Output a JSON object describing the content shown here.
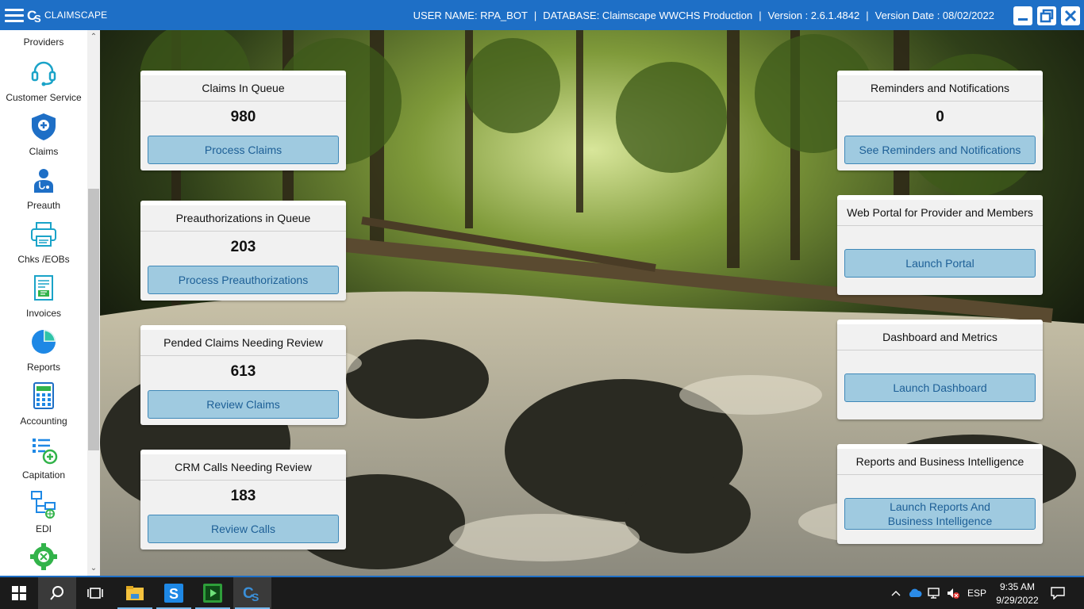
{
  "titlebar": {
    "app_name": "CLAIMSCAPE",
    "user_label": "USER NAME: RPA_BOT",
    "database_label": "DATABASE: Claimscape WWCHS Production",
    "version_label": "Version : 2.6.1.4842",
    "version_date_label": "Version Date : 08/02/2022",
    "separator": "|",
    "brand_color": "#1e6fc6"
  },
  "sidebar": {
    "items": [
      {
        "label": "Providers",
        "icon": "providers-icon"
      },
      {
        "label": "Customer Service",
        "icon": "headset-icon"
      },
      {
        "label": "Claims",
        "icon": "shield-plus-icon"
      },
      {
        "label": "Preauth",
        "icon": "doctor-icon"
      },
      {
        "label": "Chks /EOBs",
        "icon": "printer-icon"
      },
      {
        "label": "Invoices",
        "icon": "invoice-icon"
      },
      {
        "label": "Reports",
        "icon": "pie-chart-icon"
      },
      {
        "label": "Accounting",
        "icon": "calculator-icon"
      },
      {
        "label": "Capitation",
        "icon": "list-plus-icon"
      },
      {
        "label": "EDI",
        "icon": "network-icon"
      },
      {
        "label": "",
        "icon": "settings-gear-icon"
      }
    ]
  },
  "left_cards": [
    {
      "title": "Claims In Queue",
      "count": "980",
      "button": "Process Claims"
    },
    {
      "title": "Preauthorizations in Queue",
      "count": "203",
      "button": "Process Preauthorizations"
    },
    {
      "title": "Pended Claims Needing Review",
      "count": "613",
      "button": "Review Claims"
    },
    {
      "title": "CRM Calls Needing Review",
      "count": "183",
      "button": "Review Calls"
    }
  ],
  "right_cards": [
    {
      "title": "Reminders and Notifications",
      "count": "0",
      "button": "See Reminders and Notifications"
    },
    {
      "title": "Web Portal for Provider and Members",
      "count": "",
      "button": "Launch Portal"
    },
    {
      "title": "Dashboard and Metrics",
      "count": "",
      "button": "Launch Dashboard"
    },
    {
      "title": "Reports and Business Intelligence",
      "count": "",
      "button": "Launch Reports And Business Intelligence"
    }
  ],
  "taskbar": {
    "language": "ESP",
    "time": "9:35 AM",
    "date": "9/29/2022"
  }
}
